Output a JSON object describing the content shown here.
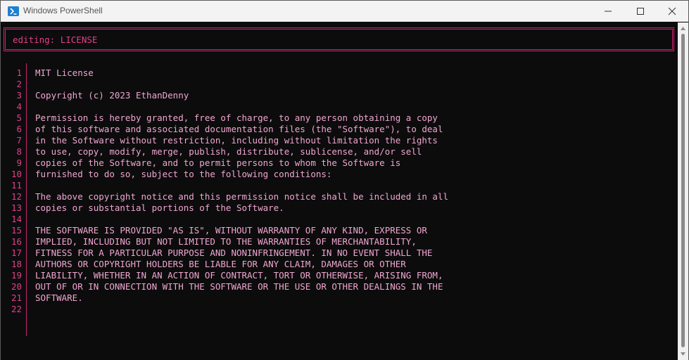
{
  "window": {
    "title": "Windows PowerShell"
  },
  "icons": {
    "app": "powershell-icon",
    "minimize": "minimize-icon",
    "maximize": "maximize-icon",
    "close": "close-icon",
    "scroll_up": "scroll-up-arrow-icon",
    "scroll_down": "scroll-down-arrow-icon"
  },
  "colors": {
    "accent": "#d0206e",
    "line_number": "#e0408a",
    "text": "#f0a6d2",
    "background": "#0c0c0c"
  },
  "editor": {
    "status": "editing: LICENSE",
    "lines": [
      {
        "no": "1",
        "text": "MIT License"
      },
      {
        "no": "2",
        "text": ""
      },
      {
        "no": "3",
        "text": "Copyright (c) 2023 EthanDenny"
      },
      {
        "no": "4",
        "text": ""
      },
      {
        "no": "5",
        "text": "Permission is hereby granted, free of charge, to any person obtaining a copy"
      },
      {
        "no": "6",
        "text": "of this software and associated documentation files (the \"Software\"), to deal"
      },
      {
        "no": "7",
        "text": "in the Software without restriction, including without limitation the rights"
      },
      {
        "no": "8",
        "text": "to use, copy, modify, merge, publish, distribute, sublicense, and/or sell"
      },
      {
        "no": "9",
        "text": "copies of the Software, and to permit persons to whom the Software is"
      },
      {
        "no": "10",
        "text": "furnished to do so, subject to the following conditions:"
      },
      {
        "no": "11",
        "text": ""
      },
      {
        "no": "12",
        "text": "The above copyright notice and this permission notice shall be included in all"
      },
      {
        "no": "13",
        "text": "copies or substantial portions of the Software."
      },
      {
        "no": "14",
        "text": ""
      },
      {
        "no": "15",
        "text": "THE SOFTWARE IS PROVIDED \"AS IS\", WITHOUT WARRANTY OF ANY KIND, EXPRESS OR"
      },
      {
        "no": "16",
        "text": "IMPLIED, INCLUDING BUT NOT LIMITED TO THE WARRANTIES OF MERCHANTABILITY,"
      },
      {
        "no": "17",
        "text": "FITNESS FOR A PARTICULAR PURPOSE AND NONINFRINGEMENT. IN NO EVENT SHALL THE"
      },
      {
        "no": "18",
        "text": "AUTHORS OR COPYRIGHT HOLDERS BE LIABLE FOR ANY CLAIM, DAMAGES OR OTHER"
      },
      {
        "no": "19",
        "text": "LIABILITY, WHETHER IN AN ACTION OF CONTRACT, TORT OR OTHERWISE, ARISING FROM,"
      },
      {
        "no": "20",
        "text": "OUT OF OR IN CONNECTION WITH THE SOFTWARE OR THE USE OR OTHER DEALINGS IN THE"
      },
      {
        "no": "21",
        "text": "SOFTWARE."
      },
      {
        "no": "22",
        "text": ""
      }
    ]
  }
}
